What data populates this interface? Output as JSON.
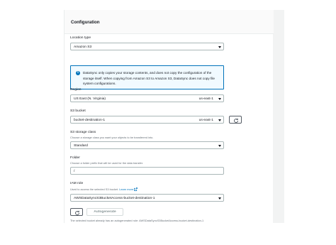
{
  "section": {
    "title": "Configuration"
  },
  "location_type": {
    "label": "Location type",
    "value": "Amazon S3"
  },
  "info": {
    "icon": "info-icon",
    "text": "DataSync only copies your storage contents, and does not copy the configuration of the storage itself. When copying from Amazon S3 to Amazon S3, DataSync does not copy file system configurations."
  },
  "region": {
    "label": "Region",
    "value": "US East (N. Virginia)",
    "code": "us-east-1"
  },
  "s3_bucket": {
    "label": "S3 bucket",
    "value": "bucket-destination-1",
    "code": "us-east-1",
    "refresh_icon": "refresh-icon"
  },
  "storage_class": {
    "label": "S3 storage class",
    "description": "Choose a storage class you want your objects to be transferred into.",
    "value": "Standard"
  },
  "folder": {
    "label": "Folder",
    "description": "Choose a folder prefix that will be used for the data transfer.",
    "value": "/"
  },
  "iam_role": {
    "label": "IAM role",
    "description": "Used to access the selected S3 bucket.",
    "learn_more": "Learn more",
    "value": "AWSDataSyncS3BucketAccess-bucket-destination-1",
    "autogenerate_label": "Autogenerate",
    "note": "The selected bucket already has an autogenerated role: AWSDataSyncS3BucketAccess-bucket-destination-1"
  }
}
